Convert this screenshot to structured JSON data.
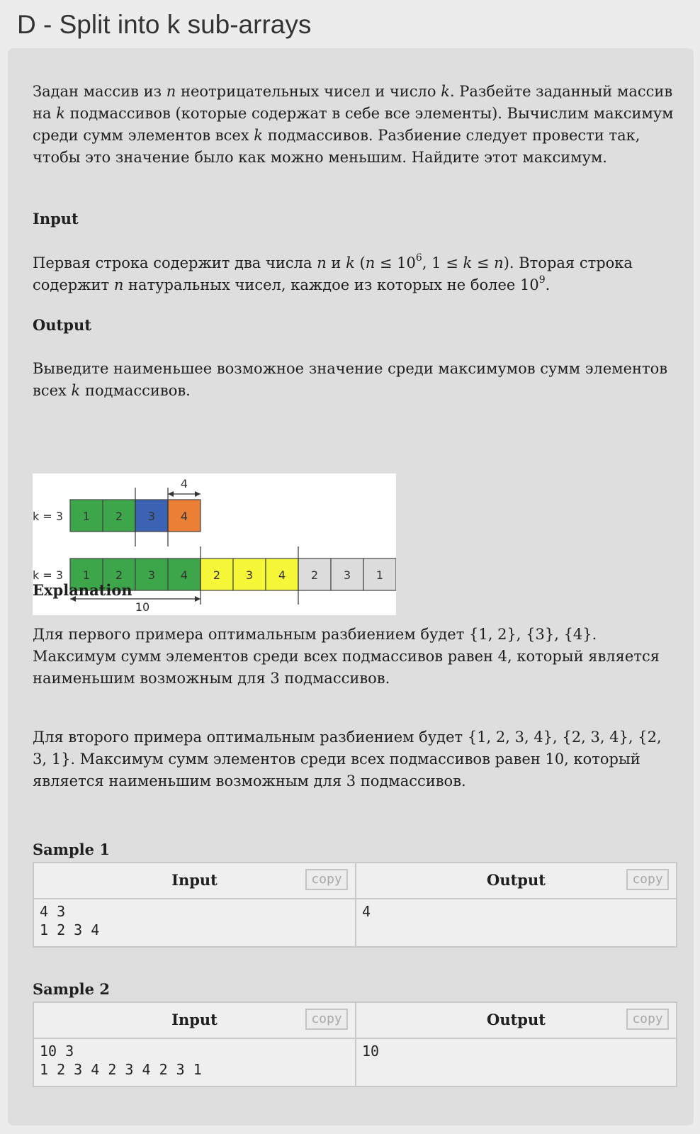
{
  "title": "D - Split into k sub-arrays",
  "statement": {
    "p1": {
      "t1": "Задан массив из ",
      "n": "n",
      "t2": " неотрицательных чисел и число ",
      "k": "k",
      "t3": ". Разбейте заданный массив на ",
      "k2": "k",
      "t4": " подмассивов (которые содержат в себе все элементы). Вычислим максимум среди сумм элементов всех ",
      "k3": "k",
      "t5": " подмассивов. Разбиение следует провести так, чтобы это значение было как можно меньшим. Найдите этот максимум."
    },
    "input_heading": "Input",
    "input": {
      "t1": "Первая строка содержит два числа ",
      "n": "n",
      "t2": " и ",
      "k": "k",
      "t3": " (",
      "n2": "n",
      "t4": " ≤ 10",
      "exp1": "6",
      "t5": ", 1 ≤ ",
      "k2": "k",
      "t6": " ≤ ",
      "n3": "n",
      "t7": "). Вторая строка содержит ",
      "n4": "n",
      "t8": " натуральных чисел, каждое из которых не более 10",
      "exp2": "9",
      "t9": "."
    },
    "output_heading": "Output",
    "output": {
      "t1": "Выведите наименьшее возможное значение среди максимумов сумм элементов всех ",
      "k": "k",
      "t2": " подмассивов."
    },
    "explanation_heading": "Explanation",
    "explanation1": "Для первого примера оптимальным разбиением будет {1, 2}, {3}, {4}. Максимум сумм элементов среди всех подмассивов равен 4, который является наименьшим возможным для 3 подмассивов.",
    "explanation2": "Для второго примера оптимальным разбиением будет {1, 2, 3, 4}, {2, 3, 4}, {2, 3, 1}. Максимум сумм элементов среди всех подмассивов равен 10, который является наименьшим возможным для 3 подмассивов."
  },
  "diagram": {
    "row1": {
      "label": "k = 3",
      "cells": [
        "1",
        "2",
        "3",
        "4"
      ],
      "colors": [
        "#3da64a",
        "#3da64a",
        "#3b62b3",
        "#ea7f35"
      ],
      "measure": "4"
    },
    "row2": {
      "label": "k = 3",
      "cells": [
        "1",
        "2",
        "3",
        "4",
        "2",
        "3",
        "4",
        "2",
        "3",
        "1"
      ],
      "colors": [
        "#3da64a",
        "#3da64a",
        "#3da64a",
        "#3da64a",
        "#f7f73a",
        "#f7f73a",
        "#f7f73a",
        "#dcdcdc",
        "#dcdcdc",
        "#dcdcdc"
      ],
      "measure": "10"
    }
  },
  "samples": [
    {
      "title": "Sample 1",
      "input_label": "Input",
      "output_label": "Output",
      "copy_label": "copy",
      "input": "4 3\n1 2 3 4",
      "output": "4"
    },
    {
      "title": "Sample 2",
      "input_label": "Input",
      "output_label": "Output",
      "copy_label": "copy",
      "input": "10 3\n1 2 3 4 2 3 4 2 3 1",
      "output": "10"
    }
  ]
}
